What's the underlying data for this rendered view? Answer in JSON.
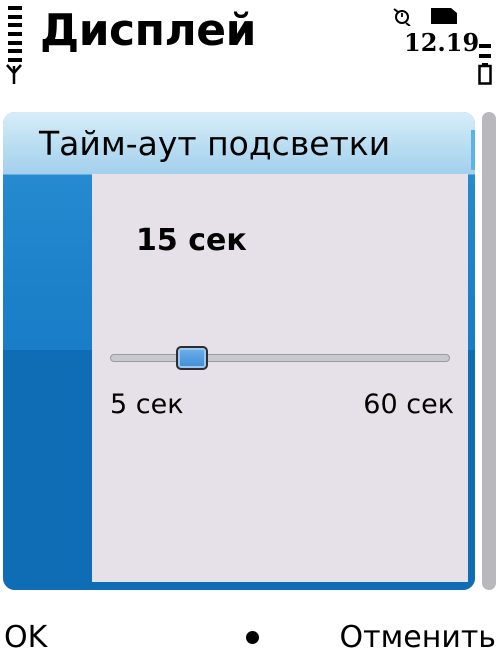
{
  "status_bar": {
    "title": "Дисплей",
    "time": "12.19",
    "signal_icon": "signal-strength-icon",
    "antenna_icon": "antenna-icon",
    "alarm_icon": "alarm-icon",
    "sim_icon": "sim-card-icon",
    "battery_icon": "battery-icon"
  },
  "dialog": {
    "title": "Тайм-аут подсветки",
    "current_value": "15 сек",
    "slider": {
      "min_label": "5 сек",
      "max_label": "60 сек",
      "min": 5,
      "max": 60,
      "value": 15
    }
  },
  "softkeys": {
    "left": "OK",
    "right": "Отменить",
    "middle_icon": "selection-dot-icon"
  },
  "colors": {
    "panel_blue": "#1a7ec8",
    "title_strip": "#b6dcf1",
    "dialog_background": "#e6e1e8",
    "thumb_blue": "#3d8ed6"
  }
}
